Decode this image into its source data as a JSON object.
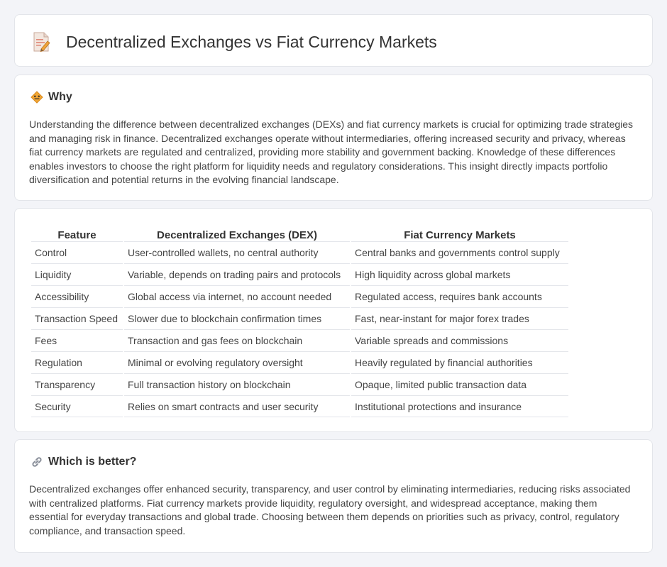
{
  "header": {
    "title": "Decentralized Exchanges vs Fiat Currency Markets",
    "icon": "document-pencil-icon"
  },
  "why": {
    "heading": "Why",
    "icon": "diamond-sign-icon",
    "text": "Understanding the difference between decentralized exchanges (DEXs) and fiat currency markets is crucial for optimizing trade strategies and managing risk in finance. Decentralized exchanges operate without intermediaries, offering increased security and privacy, whereas fiat currency markets are regulated and centralized, providing more stability and government backing. Knowledge of these differences enables investors to choose the right platform for liquidity needs and regulatory considerations. This insight directly impacts portfolio diversification and potential returns in the evolving financial landscape."
  },
  "comparison": {
    "columns": [
      "Feature",
      "Decentralized Exchanges (DEX)",
      "Fiat Currency Markets"
    ],
    "rows": [
      [
        "Control",
        "User-controlled wallets, no central authority",
        "Central banks and governments control supply"
      ],
      [
        "Liquidity",
        "Variable, depends on trading pairs and protocols",
        "High liquidity across global markets"
      ],
      [
        "Accessibility",
        "Global access via internet, no account needed",
        "Regulated access, requires bank accounts"
      ],
      [
        "Transaction Speed",
        "Slower due to blockchain confirmation times",
        "Fast, near-instant for major forex trades"
      ],
      [
        "Fees",
        "Transaction and gas fees on blockchain",
        "Variable spreads and commissions"
      ],
      [
        "Regulation",
        "Minimal or evolving regulatory oversight",
        "Heavily regulated by financial authorities"
      ],
      [
        "Transparency",
        "Full transaction history on blockchain",
        "Opaque, limited public transaction data"
      ],
      [
        "Security",
        "Relies on smart contracts and user security",
        "Institutional protections and insurance"
      ]
    ]
  },
  "better": {
    "heading": "Which is better?",
    "icon": "link-icon",
    "text": "Decentralized exchanges offer enhanced security, transparency, and user control by eliminating intermediaries, reducing risks associated with centralized platforms. Fiat currency markets provide liquidity, regulatory oversight, and widespread acceptance, making them essential for everyday transactions and global trade. Choosing between them depends on priorities such as privacy, control, regulatory compliance, and transaction speed."
  }
}
